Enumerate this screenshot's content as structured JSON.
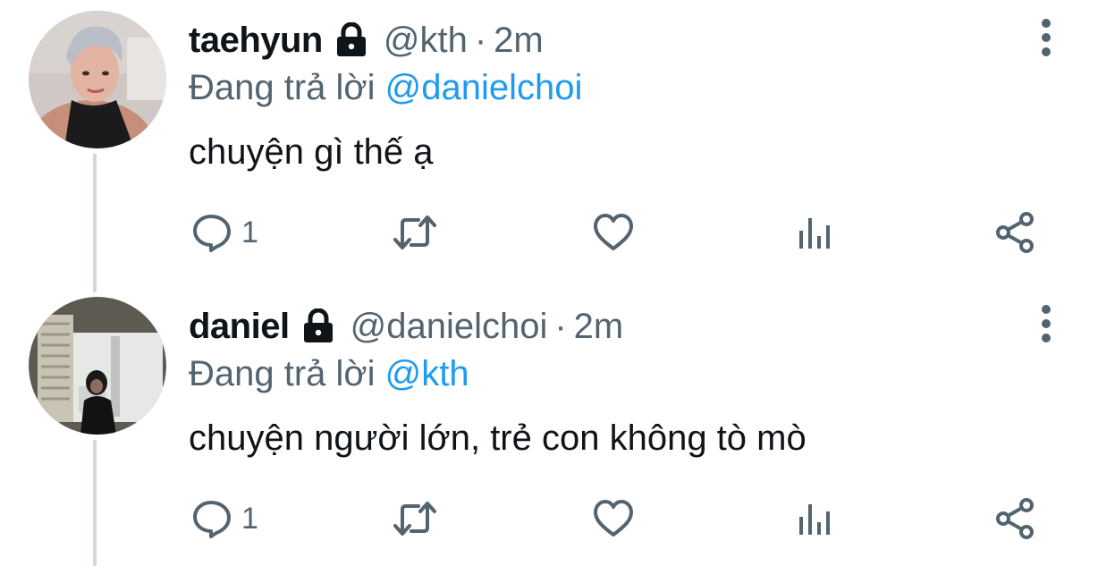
{
  "tweets": [
    {
      "name": "taehyun",
      "handle": "@kth",
      "separator": "·",
      "time": "2m",
      "replying_prefix": "Đang trả lời",
      "replying_to": "@danielchoi",
      "text": "chuyện gì thế ạ",
      "reply_count": "1",
      "icons": {
        "lock": "lock-icon",
        "more": "more-vertical-icon",
        "reply": "reply-icon",
        "retweet": "retweet-icon",
        "like": "heart-icon",
        "analytics": "analytics-icon",
        "share": "share-icon"
      }
    },
    {
      "name": "daniel",
      "handle": "@danielchoi",
      "separator": "·",
      "time": "2m",
      "replying_prefix": "Đang trả lời",
      "replying_to": "@kth",
      "text": "chuyện người lớn, trẻ con không tò mò",
      "reply_count": "1",
      "icons": {
        "lock": "lock-icon",
        "more": "more-vertical-icon",
        "reply": "reply-icon",
        "retweet": "retweet-icon",
        "like": "heart-icon",
        "analytics": "analytics-icon",
        "share": "share-icon"
      }
    }
  ],
  "colors": {
    "text": "#0f1419",
    "secondary": "#536471",
    "mention": "#1d9bf0",
    "thread_line": "#cfd9de",
    "background": "#ffffff"
  }
}
